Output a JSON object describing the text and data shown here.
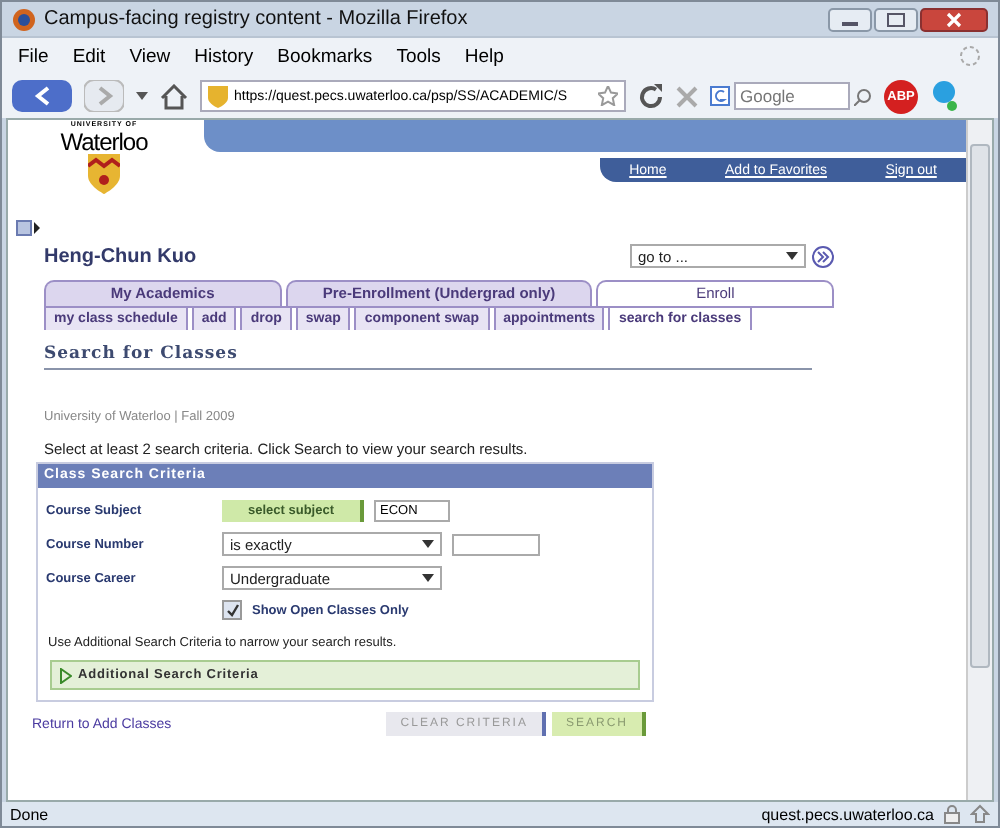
{
  "window": {
    "title": "Campus-facing registry content - Mozilla Firefox"
  },
  "menu": [
    "File",
    "Edit",
    "View",
    "History",
    "Bookmarks",
    "Tools",
    "Help"
  ],
  "toolbar": {
    "url": "https://quest.pecs.uwaterloo.ca/psp/SS/ACADEMIC/S",
    "search_placeholder": "Google",
    "adblock_label": "ABP"
  },
  "header": {
    "logo_small": "UNIVERSITY OF",
    "logo_name": "Waterloo",
    "links": [
      "Home",
      "Add to Favorites",
      "Sign out"
    ]
  },
  "user_name": "Heng-Chun Kuo",
  "goto": {
    "value": "go to ..."
  },
  "tabs": [
    {
      "label": "My Academics",
      "selected": false
    },
    {
      "label": "Pre-Enrollment (Undergrad only)",
      "selected": false
    },
    {
      "label": "Enroll",
      "selected": true
    }
  ],
  "subtabs": [
    {
      "label": "my class schedule",
      "selected": false
    },
    {
      "label": "add",
      "selected": false
    },
    {
      "label": "drop",
      "selected": false
    },
    {
      "label": "swap",
      "selected": false
    },
    {
      "label": "component swap",
      "selected": false
    },
    {
      "label": "appointments",
      "selected": false
    },
    {
      "label": "search for classes",
      "selected": true
    }
  ],
  "page_title": "Search for Classes",
  "term": "University of Waterloo | Fall 2009",
  "instructions": "Select at least 2 search criteria. Click Search to view your search results.",
  "criteria": {
    "title": "Class Search Criteria",
    "subject": {
      "label": "Course Subject",
      "button": "select subject",
      "value": "ECON"
    },
    "number": {
      "label": "Course Number",
      "operator": "is exactly"
    },
    "career": {
      "label": "Course Career",
      "value": "Undergraduate"
    },
    "open_only": {
      "label": "Show Open Classes Only",
      "checked": true
    },
    "note": "Use Additional Search Criteria to narrow your search results.",
    "additional": {
      "label": "Additional Search Criteria",
      "expanded": false
    }
  },
  "return_link": "Return to Add Classes",
  "buttons": [
    "CLEAR CRITERIA",
    "SEARCH"
  ],
  "status_bar": {
    "text": "Done",
    "host": "quest.pecs.uwaterloo.ca"
  }
}
